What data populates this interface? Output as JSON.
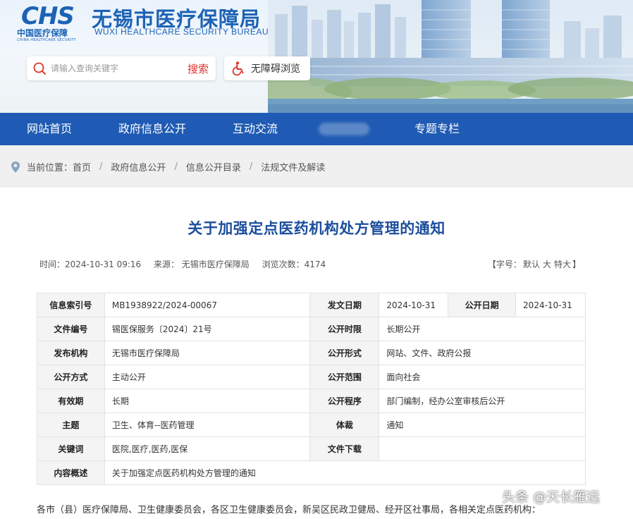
{
  "header": {
    "logo_mark": "CHS",
    "logo_cn": "中国医疗保障",
    "logo_en": "CHINA HEALTHCARE SECURITY",
    "bureau_cn": "无锡市医疗保障局",
    "bureau_en": "WUXI HEALTHCARE SECURITY BUREAU",
    "search_placeholder": "请输入查询关键字",
    "search_button": "搜索",
    "accessibility_button": "无障碍浏览",
    "colors": {
      "brand": "#1d62b5",
      "search_button": "#e0332b"
    }
  },
  "nav": {
    "items": [
      "网站首页",
      "政府信息公开",
      "互动交流",
      "专题专栏"
    ],
    "background": "#1f5bb4"
  },
  "breadcrumb": {
    "prefix": "当前位置：",
    "items": [
      "首页",
      "政府信息公开",
      "信息公开目录",
      "法规文件及解读"
    ],
    "separator": "/"
  },
  "article": {
    "title": "关于加强定点医药机构处方管理的通知",
    "meta": {
      "time": "时间：2024-10-31 09:16",
      "source": "来源： 无锡市医疗保障局",
      "views": "浏览次数：4174"
    },
    "fontsize": {
      "prefix": "【字号：",
      "default": "默认",
      "large": "大",
      "xlarge": "特大",
      "suffix": "】"
    },
    "info_rows": [
      {
        "l1": "信息索引号",
        "v1": "MB1938922/2024-00067",
        "l2": "发文日期",
        "v2": "2024-10-31",
        "l3": "公开日期",
        "v3": "2024-10-31"
      },
      {
        "l1": "文件编号",
        "v1": "锡医保服务〔2024〕21号",
        "l2": "公开时限",
        "v2": "长期公开"
      },
      {
        "l1": "发布机构",
        "v1": "无锡市医疗保障局",
        "l2": "公开形式",
        "v2": "网站、文件、政府公报"
      },
      {
        "l1": "公开方式",
        "v1": "主动公开",
        "l2": "公开范围",
        "v2": "面向社会"
      },
      {
        "l1": "有效期",
        "v1": "长期",
        "l2": "公开程序",
        "v2": "部门编制，经办公室审核后公开"
      },
      {
        "l1": "主题",
        "v1": "卫生、体育--医药管理",
        "l2": "体裁",
        "v2": "通知"
      },
      {
        "l1": "关键词",
        "v1": "医院,医疗,医药,医保",
        "l2": "文件下载",
        "v2": ""
      },
      {
        "l1": "内容概述",
        "v1": "关于加强定点医药机构处方管理的通知"
      }
    ],
    "body_first_line": "各市（县）医疗保障局、卫生健康委员会，各区卫生健康委员会，新吴区民政卫健局、经开区社事局，各相关定点医药机构：",
    "title_color": "#1c4e9c"
  },
  "watermark": "头条 @天长雁远"
}
